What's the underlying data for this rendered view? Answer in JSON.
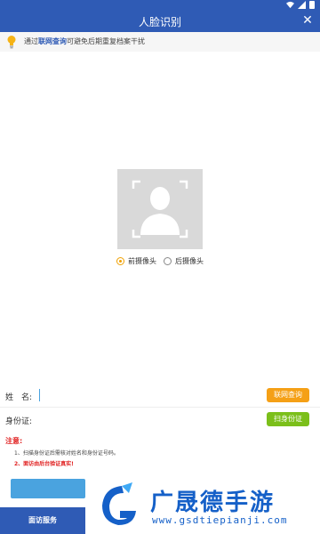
{
  "header": {
    "title": "人脸识别",
    "close_label": "✕"
  },
  "tip": {
    "prefix": "通过",
    "link": "联网查询",
    "suffix": "可避免后期重复档案干扰"
  },
  "camera": {
    "front_label": "前摄像头",
    "back_label": "后摄像头",
    "selected": "front"
  },
  "form": {
    "name_label": "姓　名:",
    "name_value": "",
    "lookup_button": "联网查询",
    "id_label": "身份证:",
    "id_value": "",
    "scan_button": "扫身份证"
  },
  "notice": {
    "title": "注意:",
    "item1": "1、扫描身份证后需核对姓名和身份证号码。",
    "item2": "2、面访由后台验证真实!"
  },
  "bottom": {
    "tab_label": "面访服务"
  },
  "watermark": {
    "title": "广晟德手游",
    "url": "www.gsdtiepianji.com"
  },
  "colors": {
    "primary": "#2f5bb5",
    "orange": "#f5a016",
    "green": "#7bbf1a",
    "alert": "#e02020",
    "accent_blue": "#4aa3df"
  },
  "icons": [
    "wifi-icon",
    "signal-icon",
    "battery-icon",
    "close-icon",
    "lightbulb-icon",
    "person-silhouette-icon",
    "watermark-logo-icon"
  ]
}
